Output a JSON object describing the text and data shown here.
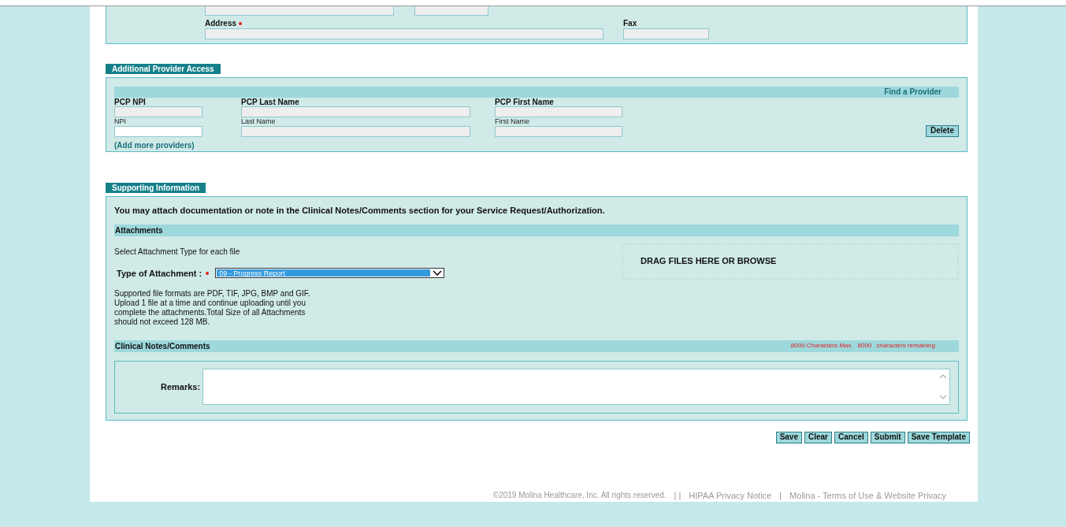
{
  "contact_panel": {
    "cut_fields": [
      {
        "disabled": true
      },
      {
        "disabled": true
      }
    ],
    "fields": [
      {
        "label": "Address",
        "required": true,
        "disabled": true
      },
      {
        "label": "Fax",
        "required": false,
        "disabled": true
      }
    ]
  },
  "provider_access": {
    "title": "Additional Provider Access",
    "find_link": "Find a Provider",
    "rows": [
      {
        "kind": "pcp",
        "fields": [
          {
            "label": "PCP NPI",
            "disabled": true
          },
          {
            "label": "PCP Last Name",
            "disabled": true
          },
          {
            "label": "PCP First Name",
            "disabled": true
          }
        ]
      },
      {
        "kind": "other",
        "fields": [
          {
            "label": "NPI",
            "disabled": false
          },
          {
            "label": "Last Name",
            "disabled": true
          },
          {
            "label": "First Name",
            "disabled": true
          }
        ],
        "action": "Delete"
      }
    ],
    "add_link": "(Add more providers)"
  },
  "supporting": {
    "title": "Supporting Information",
    "intro": "You may attach documentation or note in the Clinical Notes/Comments section for your Service Request/Authorization.",
    "attachments": {
      "heading": "Attachments",
      "instruction": "Select Attachment Type for each file",
      "type_label": "Type of Attachment :",
      "required": true,
      "type_value": "09 - Progress Report",
      "note": "Supported file formats are PDF, TIF, JPG, BMP and GIF. Upload 1 file at a time and continue uploading until you complete the attachments.Total Size of all Attachments should not exceed 128 MB.",
      "dropzone": "DRAG FILES HERE OR BROWSE"
    },
    "notes": {
      "heading": "Clinical Notes/Comments",
      "max": "8000 Characters Max.",
      "count": "8000",
      "remaining": "characters remaining",
      "remarks_label": "Remarks:"
    }
  },
  "buttons": [
    "Save",
    "Clear",
    "Cancel",
    "Submit",
    "Save Template"
  ],
  "footer": [
    {
      "kind": "text",
      "text": "©2019 Molina Healthcare, Inc. All rights reserved."
    },
    {
      "kind": "sep",
      "text": "| |"
    },
    {
      "kind": "link",
      "text": "HIPAA Privacy Notice"
    },
    {
      "kind": "sep",
      "text": "|"
    },
    {
      "kind": "link",
      "text": "Molina - Terms of Use & Website Privacy"
    }
  ]
}
